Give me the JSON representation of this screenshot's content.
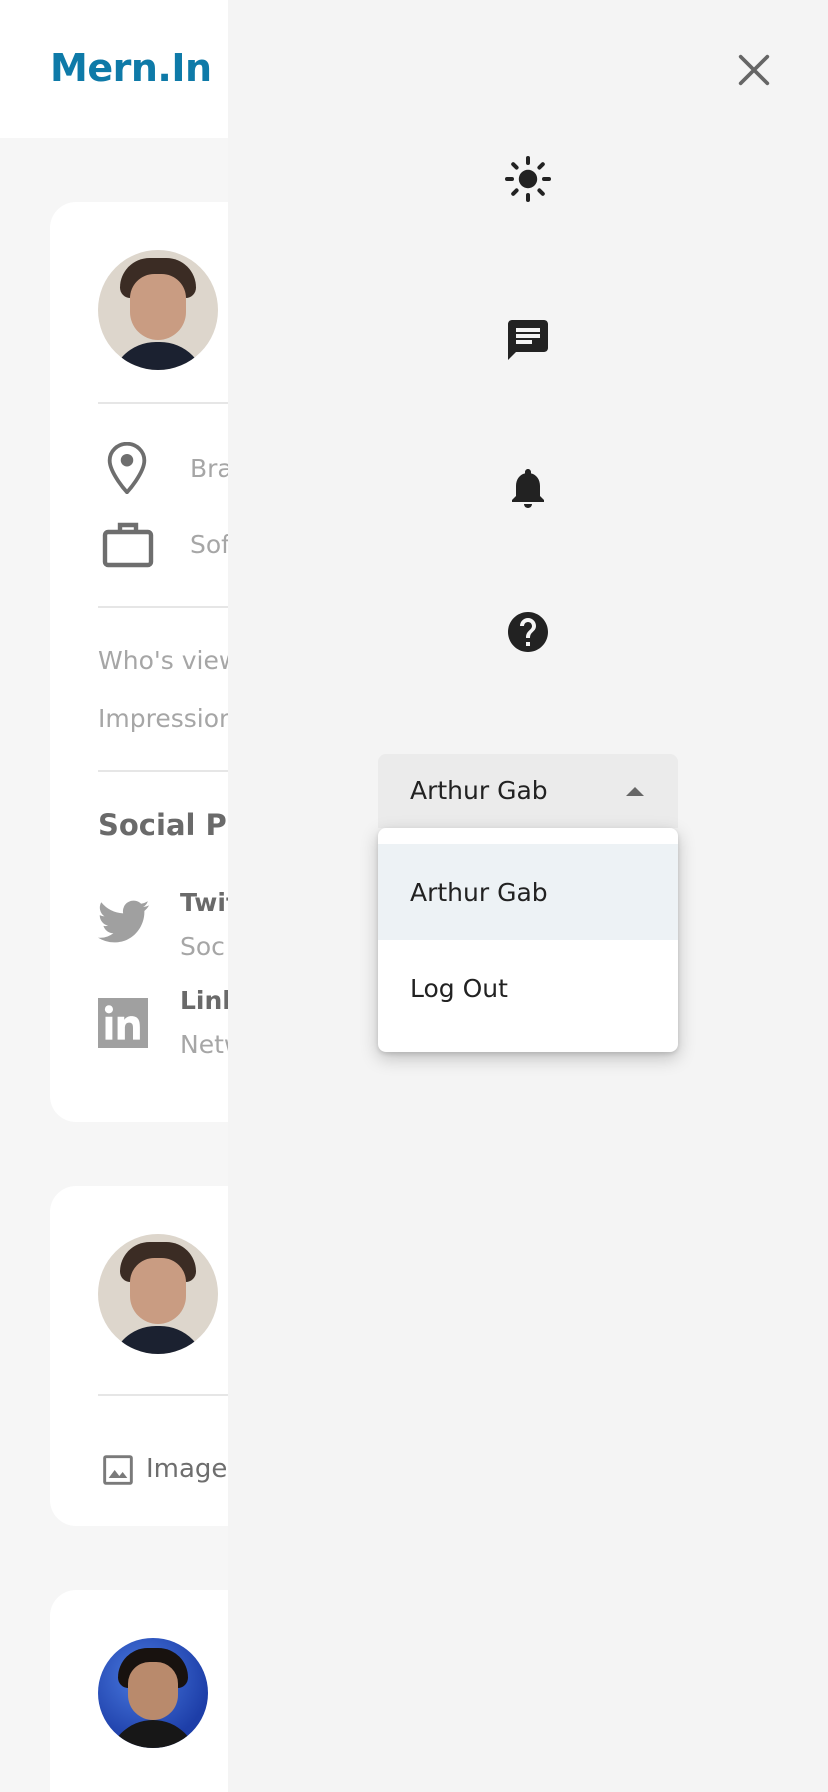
{
  "app": {
    "logo": "Mern.In"
  },
  "profile_card": {
    "location": "Bra",
    "occupation": "Sof",
    "viewers_label": "Who's view",
    "impressions_label": "Impression",
    "social_heading": "Social Pr",
    "socials": [
      {
        "name": "Twit",
        "type": "Soc"
      },
      {
        "name": "Link",
        "type": "Netw"
      }
    ]
  },
  "post_card": {
    "image_label": "Image"
  },
  "drawer": {
    "icons": [
      "close-icon",
      "light-mode-icon",
      "message-icon",
      "notification-icon",
      "help-icon"
    ],
    "user_select": {
      "value": "Arthur Gab"
    },
    "menu": {
      "items": [
        "Arthur Gab",
        "Log Out"
      ]
    }
  },
  "colors": {
    "brand": "#0e7aa8",
    "drawer_bg": "#f4f4f4",
    "selected_item_bg": "#edf2f5"
  }
}
